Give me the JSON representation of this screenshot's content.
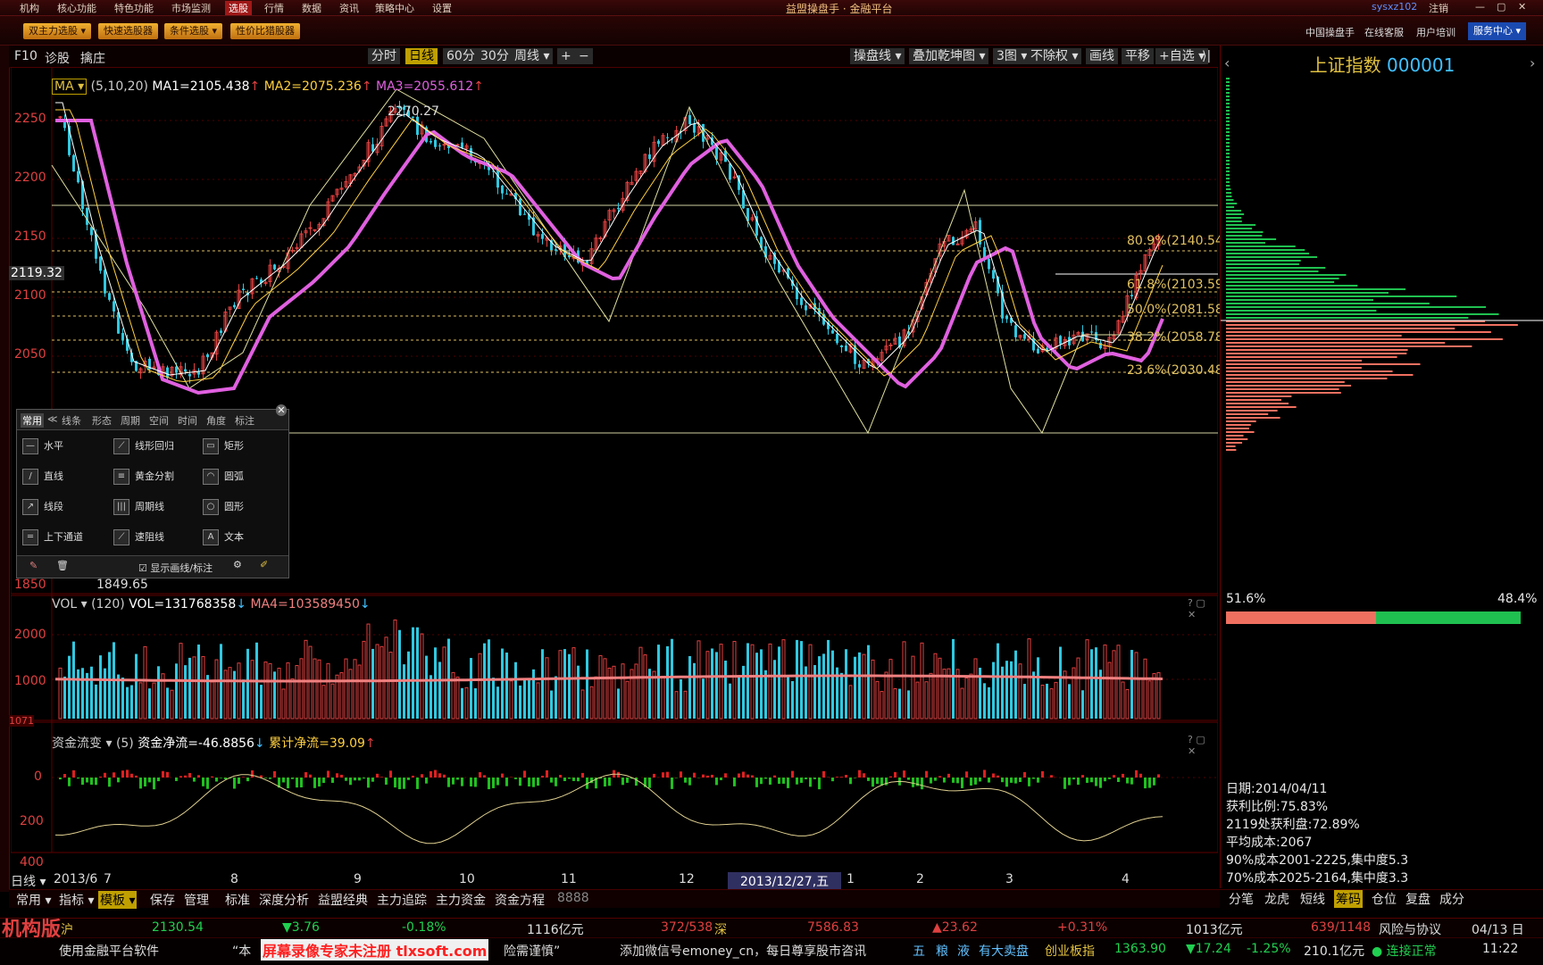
{
  "menubar": {
    "items": [
      "机构",
      "核心功能",
      "特色功能",
      "市场监测",
      "选股",
      "行情",
      "数据",
      "资讯",
      "策略中心",
      "设置"
    ],
    "active_index": 4,
    "title": "益盟操盘手 · 金融平台",
    "user": "sysxz102",
    "logout": "注销"
  },
  "toolbar2": {
    "buttons": [
      "双主力选股 ▾",
      "快速选股器",
      "条件选股 ▾",
      "性价比猎股器"
    ],
    "right_links": [
      "中国操盘手",
      "在线客服",
      "用户培训"
    ],
    "service_button": "服务中心 ▾"
  },
  "chart_header": {
    "left_labels": [
      "F10",
      "诊股",
      "擒庄"
    ],
    "period_buttons": [
      "分时",
      "日线",
      "60分",
      "30分",
      "周线 ▾"
    ],
    "selected_period": "日线",
    "zoom_buttons": [
      "+",
      "−"
    ],
    "right_buttons": [
      "操盘线 ▾",
      "叠加乾坤图 ▾",
      "3图 ▾",
      "不除权 ▾",
      "画线",
      "平移",
      "+自选 ▾"
    ],
    "collapse": "⟩|"
  },
  "colors": {
    "up": "#e04040",
    "down": "#30c8e0",
    "ma1": "#ffffff",
    "ma2": "#ffd040",
    "ma3": "#e060e0",
    "vol_ma": "#f08080",
    "grid": "#600000",
    "fib": "#e0c060"
  },
  "indicator_line": {
    "name": "MA ▾",
    "params": "(5,10,20)",
    "ma1": "MA1=2105.438",
    "ma2": "MA2=2075.236",
    "ma3": "MA3=2055.612",
    "arrow": "↑"
  },
  "vol_line": {
    "name": "VOL ▾",
    "param": "(120)",
    "vol": "VOL=131768358",
    "ma4": "MA4=103589450",
    "arrow": "↓",
    "window_icons": "? ▢ ✕"
  },
  "flow_line": {
    "name": "资金流变 ▾",
    "param": "(5)",
    "net": "资金净流=-46.8856",
    "cum": "累计净流=39.09",
    "down_arrow": "↓",
    "up_arrow": "↑",
    "window_icons": "? ▢ ✕"
  },
  "price_axis": [
    "2250",
    "2200",
    "2150",
    "2100",
    "2050",
    "1850"
  ],
  "price_tag": "2119.32",
  "vol_axis": [
    "2000",
    "1000"
  ],
  "vol_tag": "1071",
  "flow_axis": [
    "0",
    "200",
    "400"
  ],
  "annotations": {
    "high": "2270.27",
    "low": "1849.65",
    "fib": [
      "80.9%(2140.54)",
      "61.8%(2103.59)",
      "50.0%(2081.58)",
      "38.2%(2058.78)",
      "23.6%(2030.48)"
    ]
  },
  "date_axis": {
    "prefix": "日线 ▾",
    "start": "2013/6",
    "labels": [
      "7",
      "8",
      "9",
      "10",
      "11",
      "12",
      "1",
      "2",
      "3",
      "4"
    ],
    "cursor": "2013/12/27,五"
  },
  "draw_panel": {
    "tabs": [
      "常用",
      "≪",
      "线条",
      "形态",
      "周期",
      "空间",
      "时间",
      "角度",
      "标注"
    ],
    "items": [
      {
        "icon": "—",
        "label": "水平"
      },
      {
        "icon": "/",
        "label": "直线"
      },
      {
        "icon": "↗",
        "label": "线段"
      },
      {
        "icon": "═",
        "label": "上下通道"
      },
      {
        "icon": "⟋",
        "label": "线形回归"
      },
      {
        "icon": "≡",
        "label": "黄金分割"
      },
      {
        "icon": "|||",
        "label": "周期线"
      },
      {
        "icon": "⟋",
        "label": "速阻线"
      },
      {
        "icon": "▭",
        "label": "矩形"
      },
      {
        "icon": "◠",
        "label": "圆弧"
      },
      {
        "icon": "○",
        "label": "圆形"
      },
      {
        "icon": "A",
        "label": "文本"
      }
    ],
    "show_label": "显示画线/标注",
    "close": "✕"
  },
  "right_panel": {
    "title": "上证指数",
    "code": "000001",
    "left_pct": "51.6%",
    "right_pct": "48.4%",
    "info": [
      "日期:2014/04/11",
      "获利比例:75.83%",
      "2119处获利盘:72.89%",
      "平均成本:2067",
      "90%成本2001-2225,集中度5.3",
      "70%成本2025-2164,集中度3.3"
    ],
    "tabs": [
      "分笔",
      "龙虎",
      "短线",
      "筹码",
      "仓位",
      "复盘",
      "成分"
    ],
    "selected_tab": "筹码"
  },
  "bottom_tabs": {
    "items": [
      "常用 ▾",
      "指标 ▾",
      "模板 ▾",
      "保存",
      "管理",
      "标准",
      "深度分析",
      "益盟经典",
      "主力追踪",
      "主力资金",
      "资金方程",
      "8888"
    ],
    "selected": "模板 ▾"
  },
  "status1": {
    "brand": "机构版",
    "sh_label": "沪",
    "sh_price": "2130.54",
    "sh_chg": "▼3.76",
    "sh_pct": "-0.18%",
    "sh_amt": "1116亿元",
    "sh_ud": "372/538",
    "sz_label": "深",
    "sz_price": "7586.83",
    "sz_chg": "▲23.62",
    "sz_pct": "+0.31%",
    "sz_amt": "1013亿元",
    "sz_ud": "639/1148",
    "risk": "风险与协议",
    "date": "04/13 日"
  },
  "status2": {
    "ticker1": "使用金融平台软件",
    "ticker2": "“本",
    "watermark": "屏幕录像专家未注册 tlxsoft.com",
    "ticker3": "险需谨慎”",
    "ticker4": "添加微信号emoney_cn，每日尊享股市咨讯",
    "tags": [
      "五",
      "粮",
      "液",
      "有大卖盘"
    ],
    "sector": "创业板指",
    "s_price": "1363.90",
    "s_chg": "▼17.24",
    "s_pct": "-1.25%",
    "s_amt": "210.1亿元",
    "conn": "连接正常",
    "time": "11:22"
  }
}
